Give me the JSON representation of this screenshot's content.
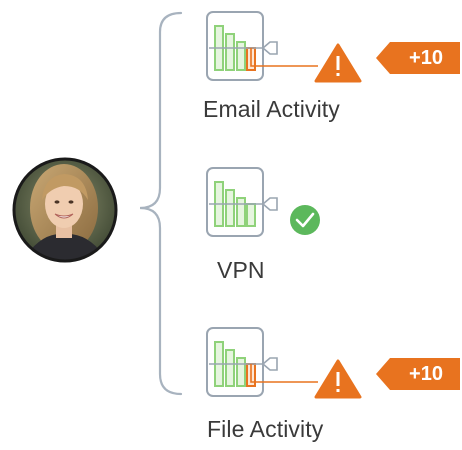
{
  "user": {
    "avatar_icon": "user-photo-avatar"
  },
  "activities": [
    {
      "label": "Email Activity",
      "icon": "bar-chart-monitor-icon",
      "status": "alert",
      "status_icon": "warning-triangle-icon",
      "score_badge": "+10"
    },
    {
      "label": "VPN",
      "icon": "bar-chart-monitor-icon",
      "status": "ok",
      "status_icon": "check-circle-icon"
    },
    {
      "label": "File Activity",
      "icon": "bar-chart-monitor-icon",
      "status": "alert",
      "status_icon": "warning-triangle-icon",
      "score_badge": "+10"
    }
  ],
  "colors": {
    "bracket": "#a8b3bf",
    "icon_frame": "#9aa5b1",
    "bar_green": "#8fd27a",
    "bar_green_fill": "#e6f5df",
    "bar_orange": "#e8731f",
    "alert_orange": "#e8731f",
    "ok_green": "#5cb85c",
    "label_text": "#3a3a3a"
  }
}
